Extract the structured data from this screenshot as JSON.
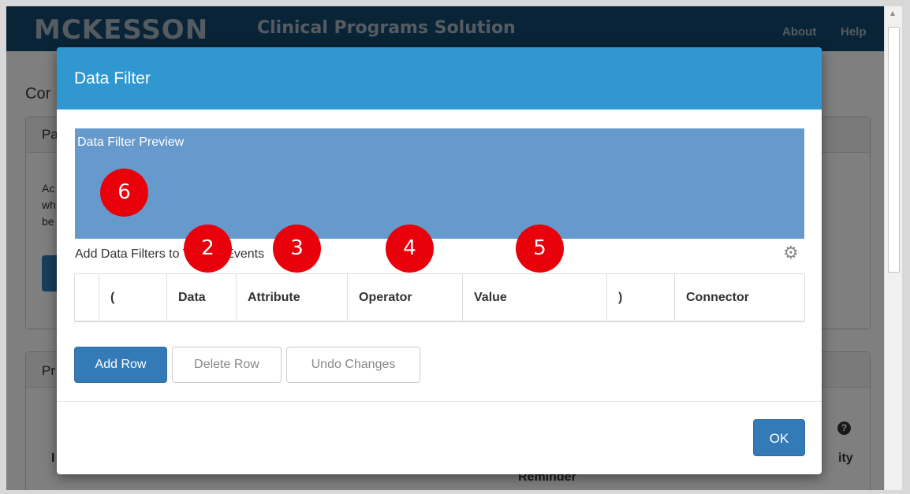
{
  "app": {
    "logo_text": "MCKESSON",
    "title": "Clinical Programs Solution",
    "nav": [
      "About",
      "Help"
    ],
    "page_heading_fragment": "Cor",
    "panel1_heading_fragment": "Pa",
    "panel1_text_fragments": [
      "Ac",
      "wh",
      "be"
    ],
    "panel2_heading_fragment": "Pr",
    "bg_table_fragments": {
      "reminder": "Reminder",
      "right_fragment": "ity",
      "left_fragment": "I"
    },
    "help_icon": "question-circle-icon"
  },
  "modal": {
    "title": "Data Filter",
    "preview_label": "Data Filter Preview",
    "section_label": "Add Data Filters to Trigger Events",
    "settings_icon": "gear-icon",
    "columns": [
      "",
      "(",
      "Data",
      "Attribute",
      "Operator",
      "Value",
      ")",
      "Connector"
    ],
    "buttons": {
      "add_row": "Add Row",
      "delete_row": "Delete Row",
      "undo_changes": "Undo Changes",
      "ok": "OK"
    }
  },
  "markers": [
    "2",
    "3",
    "4",
    "5",
    "6"
  ],
  "colors": {
    "header_bg": "#14486e",
    "modal_header": "#3197d0",
    "preview_bg": "#6699cc",
    "primary_button": "#337ab7",
    "marker_red": "#e8000b"
  }
}
